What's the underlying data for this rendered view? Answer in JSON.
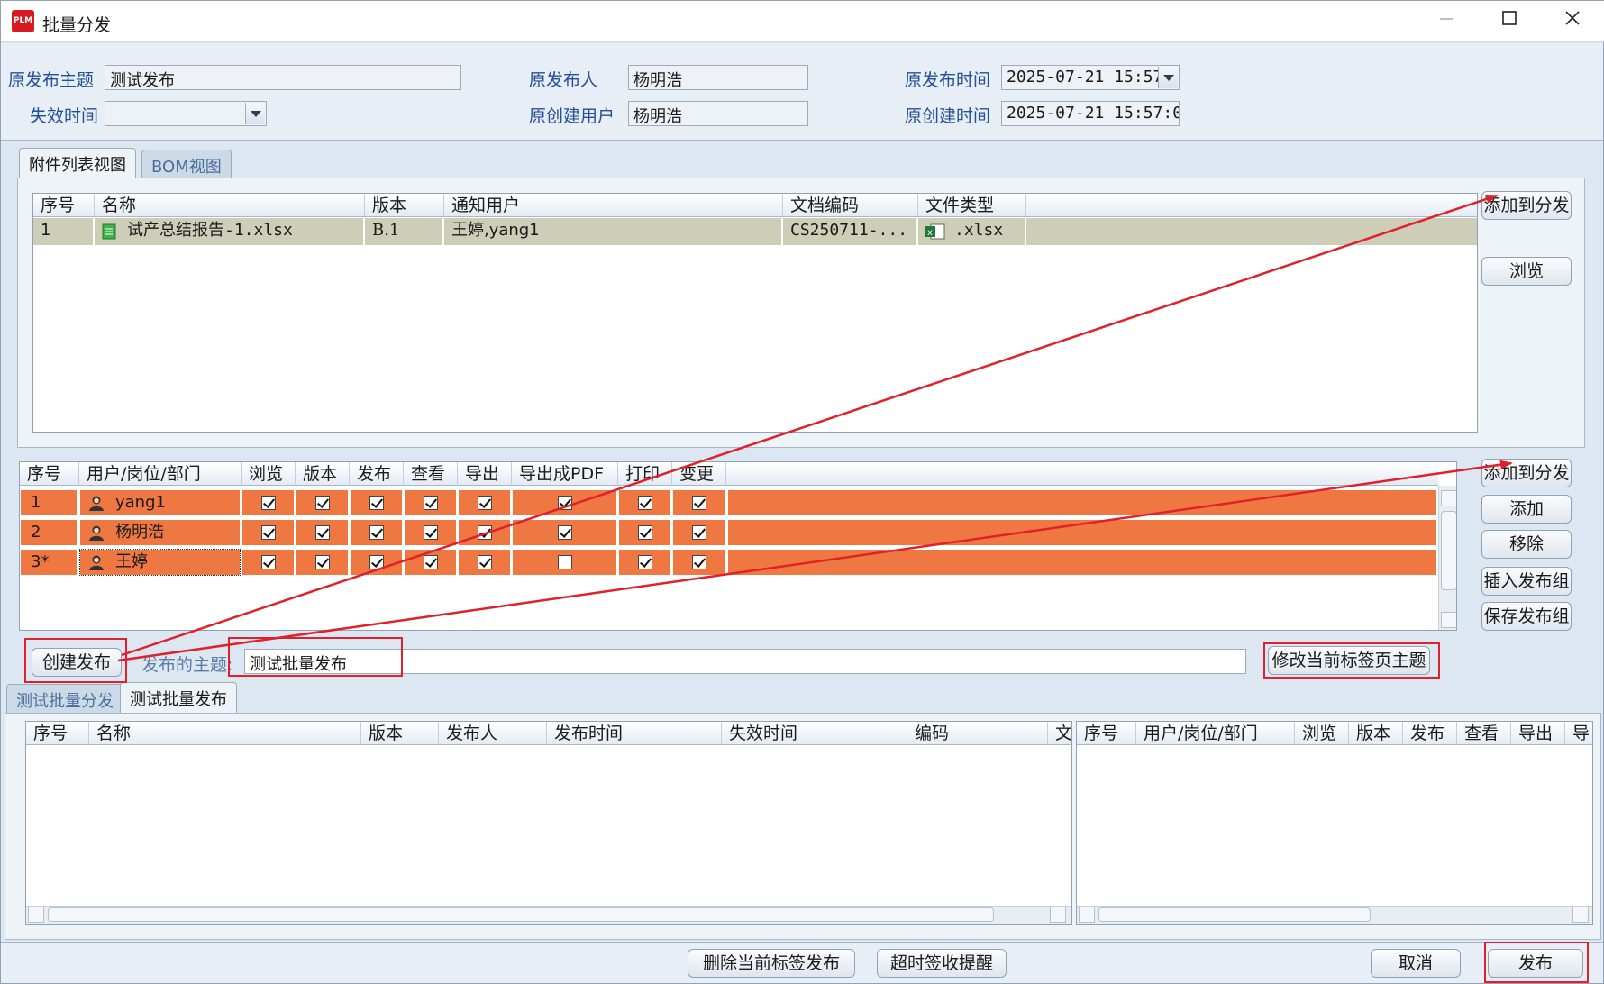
{
  "window": {
    "title": "批量分发",
    "logo": "PLM",
    "min_icon": "minimize-icon",
    "max_icon": "maximize-icon",
    "close_icon": "close-icon"
  },
  "header": {
    "orig_subject_label": "原发布主题",
    "orig_subject_value": "测试发布",
    "expire_label": "失效时间",
    "expire_value": "",
    "orig_publisher_label": "原发布人",
    "orig_publisher_value": "杨明浩",
    "orig_creator_label": "原创建用户",
    "orig_creator_value": "杨明浩",
    "orig_publish_time_label": "原发布时间",
    "orig_publish_time_value": "2025-07-21 15:57",
    "orig_create_time_label": "原创建时间",
    "orig_create_time_value": "2025-07-21 15:57:0("
  },
  "attach_tabs": [
    "附件列表视图",
    "BOM视图"
  ],
  "attach_table": {
    "headers": [
      "序号",
      "名称",
      "版本",
      "通知用户",
      "文档编码",
      "文件类型"
    ],
    "rows": [
      {
        "seq": "1",
        "name": "试产总结报告-1.xlsx",
        "version": "B.1",
        "users": "王婷,yang1",
        "code": "CS250711-...",
        "type": ".xlsx"
      }
    ]
  },
  "attach_buttons": {
    "add": "添加到分发",
    "browse": "浏览"
  },
  "perm_table": {
    "headers": [
      "序号",
      "用户/岗位/部门",
      "浏览",
      "版本",
      "发布",
      "查看",
      "导出",
      "导出成PDF",
      "打印",
      "变更"
    ],
    "rows": [
      {
        "seq": "1",
        "user": "yang1",
        "checks": [
          true,
          true,
          true,
          true,
          true,
          true,
          true,
          true
        ]
      },
      {
        "seq": "2",
        "user": "杨明浩",
        "checks": [
          true,
          true,
          true,
          true,
          true,
          true,
          true,
          true
        ]
      },
      {
        "seq": "3*",
        "user": "王婷",
        "checks": [
          true,
          true,
          true,
          true,
          true,
          false,
          true,
          true
        ]
      }
    ]
  },
  "perm_buttons": {
    "add_dist": "添加到分发",
    "add": "添加",
    "remove": "移除",
    "insert_group": "插入发布组",
    "save_group": "保存发布组"
  },
  "create_bar": {
    "create_btn": "创建发布",
    "subject_label": "发布的主题:",
    "subject_value": "测试批量发布",
    "modify_btn": "修改当前标签页主题"
  },
  "bottom_tabs": [
    "测试批量分发",
    "测试批量发布"
  ],
  "left_table": {
    "headers": [
      "序号",
      "名称",
      "版本",
      "发布人",
      "发布时间",
      "失效时间",
      "编码",
      "文"
    ]
  },
  "right_table": {
    "headers": [
      "序号",
      "用户/岗位/部门",
      "浏览",
      "版本",
      "发布",
      "查看",
      "导出",
      "导"
    ]
  },
  "footer": {
    "delete_btn": "删除当前标签发布",
    "reminder_btn": "超时签收提醒",
    "cancel_btn": "取消",
    "publish_btn": "发布"
  },
  "colors": {
    "accent_row": "#ef7842",
    "selected_row": "#cdcdb8",
    "annotation": "#e0202a",
    "label": "#234f9a"
  }
}
